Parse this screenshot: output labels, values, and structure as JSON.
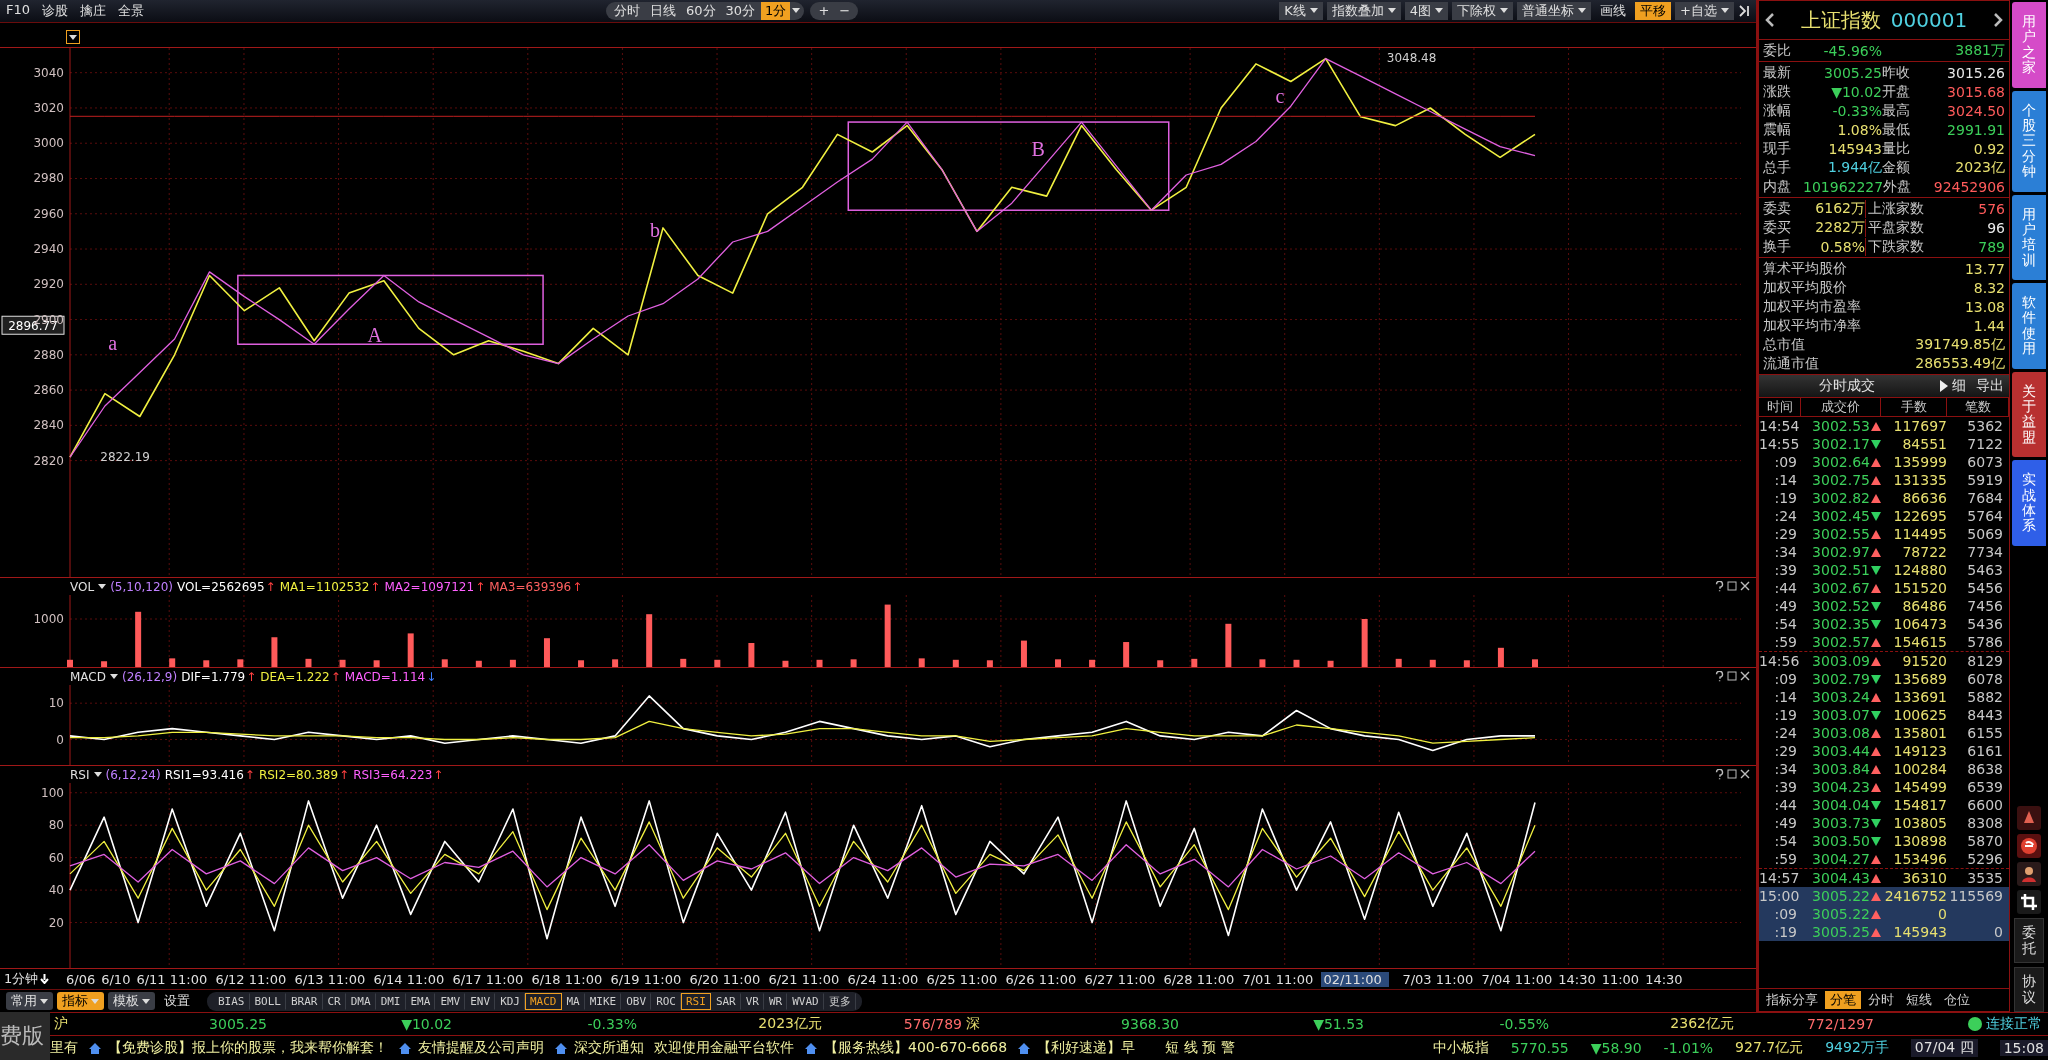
{
  "toolbar": {
    "menu": [
      {
        "label": "F10"
      },
      {
        "label": "诊股"
      },
      {
        "label": "擒庄"
      },
      {
        "label": "全景"
      }
    ],
    "periods": [
      {
        "label": "分时",
        "selected": false
      },
      {
        "label": "日线",
        "selected": false
      },
      {
        "label": "60分",
        "selected": false
      },
      {
        "label": "30分",
        "selected": false
      },
      {
        "label": "1分",
        "selected": true
      }
    ],
    "zoom": [
      "+",
      "−"
    ],
    "tools": [
      {
        "label": "K线",
        "dropdown": true,
        "selected": false
      },
      {
        "label": "指数叠加",
        "dropdown": true,
        "selected": false
      },
      {
        "label": "4图",
        "dropdown": true,
        "selected": false
      },
      {
        "label": "下除权",
        "dropdown": true,
        "selected": false
      },
      {
        "label": "普通坐标",
        "dropdown": true,
        "selected": false
      },
      {
        "label": "画线",
        "dropdown": false,
        "selected": false
      },
      {
        "label": "平移",
        "dropdown": false,
        "selected": true
      },
      {
        "label": "+自选",
        "dropdown": true,
        "selected": false
      }
    ]
  },
  "price_pane": {
    "marks": {
      "wave_labels": [
        "a",
        "A",
        "b",
        "B",
        "c"
      ],
      "low": "2822.19",
      "high": "3048.48",
      "current": "2896.77"
    },
    "chart_data": {
      "type": "line",
      "categories": [
        null,
        null,
        null,
        null,
        null,
        null,
        null,
        null,
        null,
        null,
        null,
        null,
        null,
        null,
        null,
        null,
        null,
        null,
        null,
        null,
        null,
        null,
        null,
        null,
        null,
        null,
        null,
        null,
        null,
        null,
        null,
        null,
        null,
        null,
        null,
        null,
        null,
        null,
        null,
        null,
        null,
        null,
        null
      ],
      "ylim": [
        2754,
        3054
      ],
      "grid": true,
      "yticks": [
        2820,
        2840,
        2860,
        2880,
        2900,
        2920,
        2940,
        2960,
        2980,
        3000,
        3020,
        3040
      ],
      "series": [
        {
          "color": "#f0f040",
          "values": [
            2822,
            2858,
            2845,
            2880,
            2925,
            2905,
            2918,
            2888,
            2915,
            2922,
            2895,
            2880,
            2888,
            2882,
            2875,
            2895,
            2880,
            2952,
            2925,
            2915,
            2960,
            2975,
            3005,
            2995,
            3010,
            2985,
            2950,
            2975,
            2970,
            3010,
            2985,
            2962,
            2975,
            3020,
            3045,
            3035,
            3048,
            3015,
            3010,
            3020,
            3005,
            2992,
            3005
          ]
        },
        {
          "color": "#c02020",
          "values": [
            3015.26,
            3015.26,
            3015.26,
            3015.26,
            3015.26,
            3015.26,
            3015.26,
            3015.26,
            3015.26,
            3015.26,
            3015.26,
            3015.26,
            3015.26,
            3015.26,
            3015.26,
            3015.26,
            3015.26,
            3015.26,
            3015.26,
            3015.26,
            3015.26,
            3015.26,
            3015.26,
            3015.26,
            3015.26,
            3015.26,
            3015.26,
            3015.26,
            3015.26,
            3015.26,
            3015.26,
            3015.26,
            3015.26,
            3015.26,
            3015.26,
            3015.26,
            3015.26,
            3015.26,
            3015.26,
            3015.26,
            3015.26,
            3015.26,
            3015.26
          ]
        },
        {
          "color": "#e060e0",
          "values": [
            2822,
            2851,
            2870,
            2889,
            2927,
            2913,
            2900,
            2886,
            2906,
            2925,
            2910,
            2900,
            2890,
            2880,
            2875,
            2889,
            2902,
            2909,
            2923,
            2944,
            2950,
            2964,
            2978,
            2991,
            3012,
            2985,
            2950,
            2966,
            2989,
            3012,
            2987,
            2962,
            2982,
            2988,
            3001,
            3021,
            3048,
            3038,
            3028,
            3018,
            3008,
            2998,
            2993
          ]
        }
      ]
    }
  },
  "volume_pane": {
    "title": "VOL",
    "params": "(5,10,120)",
    "readings": [
      {
        "text": "VOL=2562695",
        "arrow": "↑",
        "rising": true,
        "color": "#ffffff"
      },
      {
        "text": "MA1=1102532",
        "arrow": "↑",
        "rising": true,
        "color": "#f0f040"
      },
      {
        "text": "MA2=1097121",
        "arrow": "↑",
        "rising": true,
        "color": "#ff60ff"
      },
      {
        "text": "MA3=639396",
        "arrow": "↑",
        "rising": true,
        "color": "#ff6060"
      }
    ],
    "chart_data": {
      "type": "bar",
      "categories": [
        null,
        null,
        null,
        null,
        null,
        null,
        null,
        null,
        null,
        null,
        null,
        null,
        null,
        null,
        null,
        null,
        null,
        null,
        null,
        null,
        null,
        null,
        null,
        null,
        null,
        null,
        null,
        null,
        null,
        null,
        null,
        null,
        null,
        null,
        null,
        null,
        null,
        null,
        null,
        null,
        null,
        null,
        null,
        null
      ],
      "ylim": [
        0,
        1500
      ],
      "yticks": [
        1000
      ],
      "grid": true,
      "series": [
        {
          "color": "#ff5a5a",
          "values": [
            150,
            120,
            1150,
            180,
            140,
            160,
            620,
            170,
            150,
            140,
            700,
            160,
            130,
            150,
            600,
            140,
            160,
            1100,
            170,
            150,
            500,
            130,
            150,
            160,
            1300,
            180,
            150,
            140,
            550,
            160,
            150,
            520,
            140,
            170,
            900,
            160,
            150,
            130,
            1000,
            170,
            150,
            140,
            400,
            160
          ]
        }
      ]
    }
  },
  "macd_pane": {
    "title": "MACD",
    "params": "(26,12,9)",
    "readings": [
      {
        "text": "DIF=1.779",
        "arrow": "↑",
        "rising": true,
        "color": "#ffffff"
      },
      {
        "text": "DEA=1.222",
        "arrow": "↑",
        "rising": true,
        "color": "#f0f040"
      },
      {
        "text": "MACD=1.114",
        "arrow": "↓",
        "rising": false,
        "color": "#ff60ff"
      }
    ],
    "chart_data": {
      "type": "line",
      "categories": [
        null,
        null,
        null,
        null,
        null,
        null,
        null,
        null,
        null,
        null,
        null,
        null,
        null,
        null,
        null,
        null,
        null,
        null,
        null,
        null,
        null,
        null,
        null,
        null,
        null,
        null,
        null,
        null,
        null,
        null,
        null,
        null,
        null,
        null,
        null,
        null,
        null,
        null,
        null,
        null,
        null,
        null,
        null,
        null
      ],
      "ylim": [
        -7,
        15
      ],
      "yticks": [
        0,
        10
      ],
      "grid": true,
      "series": [
        {
          "color": "#ffffff",
          "values": [
            1,
            0,
            2,
            3,
            2,
            1,
            0,
            2,
            1,
            0,
            1,
            -1,
            0,
            1,
            0,
            -1,
            1,
            12,
            3,
            1,
            0,
            2,
            5,
            3,
            1,
            0,
            1,
            -2,
            0,
            1,
            2,
            5,
            1,
            0,
            2,
            1,
            8,
            3,
            1,
            0,
            -3,
            0,
            1,
            1
          ]
        },
        {
          "color": "#f0f040",
          "values": [
            0.5,
            0.5,
            1,
            2,
            2,
            1.5,
            1,
            1,
            1,
            0.5,
            0.5,
            0,
            0,
            0.5,
            0,
            0,
            0.5,
            5,
            3,
            2,
            1,
            1.5,
            3,
            3,
            2,
            1,
            1,
            -0.5,
            0,
            0.5,
            1,
            3,
            2,
            1,
            1,
            1,
            4,
            3,
            2,
            1,
            -1,
            -0.5,
            0,
            0.5
          ]
        }
      ]
    }
  },
  "rsi_pane": {
    "title": "RSI",
    "params": "(6,12,24)",
    "readings": [
      {
        "text": "RSI1=93.416",
        "arrow": "↑",
        "rising": true,
        "color": "#ffffff"
      },
      {
        "text": "RSI2=80.389",
        "arrow": "↑",
        "rising": true,
        "color": "#f0f040"
      },
      {
        "text": "RSI3=64.223",
        "arrow": "↑",
        "rising": true,
        "color": "#ff60ff"
      }
    ],
    "chart_data": {
      "type": "line",
      "categories": [
        null,
        null,
        null,
        null,
        null,
        null,
        null,
        null,
        null,
        null,
        null,
        null,
        null,
        null,
        null,
        null,
        null,
        null,
        null,
        null,
        null,
        null,
        null,
        null,
        null,
        null,
        null,
        null,
        null,
        null,
        null,
        null,
        null,
        null,
        null,
        null,
        null,
        null,
        null,
        null,
        null,
        null,
        null,
        null
      ],
      "ylim": [
        -8,
        106
      ],
      "yticks": [
        20,
        40,
        60,
        80,
        100
      ],
      "grid": true,
      "series": [
        {
          "color": "#ffffff",
          "values": [
            40,
            85,
            20,
            90,
            30,
            75,
            15,
            95,
            35,
            80,
            25,
            70,
            45,
            90,
            10,
            85,
            30,
            95,
            20,
            75,
            40,
            88,
            15,
            80,
            35,
            92,
            25,
            70,
            50,
            85,
            20,
            95,
            30,
            78,
            12,
            90,
            40,
            82,
            22,
            88,
            30,
            75,
            15,
            94
          ]
        },
        {
          "color": "#f0f040",
          "values": [
            50,
            70,
            35,
            78,
            40,
            65,
            30,
            80,
            45,
            70,
            38,
            62,
            50,
            76,
            28,
            72,
            40,
            82,
            35,
            66,
            48,
            75,
            30,
            70,
            45,
            80,
            38,
            62,
            52,
            74,
            35,
            82,
            42,
            68,
            28,
            78,
            48,
            72,
            36,
            76,
            40,
            66,
            30,
            80
          ]
        },
        {
          "color": "#e060e0",
          "values": [
            55,
            62,
            45,
            65,
            50,
            58,
            44,
            66,
            52,
            60,
            47,
            57,
            54,
            64,
            42,
            60,
            50,
            68,
            46,
            58,
            53,
            63,
            44,
            60,
            52,
            66,
            48,
            56,
            55,
            62,
            46,
            68,
            50,
            59,
            42,
            65,
            53,
            61,
            47,
            63,
            50,
            57,
            44,
            64
          ]
        }
      ]
    }
  },
  "x_axis": [
    {
      "text": "1分钟",
      "kind": "unit"
    },
    {
      "text": "6/06",
      "kind": "day"
    },
    {
      "text": "6/10",
      "kind": "day"
    },
    {
      "text": "6/11 11:00",
      "kind": "date"
    },
    {
      "text": "6/12 11:00",
      "kind": "date"
    },
    {
      "text": "6/13 11:00",
      "kind": "date"
    },
    {
      "text": "6/14 11:00",
      "kind": "date"
    },
    {
      "text": "6/17 11:00",
      "kind": "date"
    },
    {
      "text": "6/18 11:00",
      "kind": "date"
    },
    {
      "text": "6/19 11:00",
      "kind": "date"
    },
    {
      "text": "6/20 11:00",
      "kind": "date"
    },
    {
      "text": "6/21 11:00",
      "kind": "date"
    },
    {
      "text": "6/24 11:00",
      "kind": "date"
    },
    {
      "text": "6/25 11:00",
      "kind": "date"
    },
    {
      "text": "6/26 11:00",
      "kind": "date"
    },
    {
      "text": "6/27 11:00",
      "kind": "date"
    },
    {
      "text": "6/28 11:00",
      "kind": "date"
    },
    {
      "text": "7/01 11:00",
      "kind": "date"
    },
    {
      "text": "02/11:00",
      "kind": "cursor"
    },
    {
      "text": "7/03 11:00",
      "kind": "date"
    },
    {
      "text": "7/04 11:00",
      "kind": "day"
    },
    {
      "text": "14:30",
      "kind": "day"
    },
    {
      "text": "11:00",
      "kind": "day"
    },
    {
      "text": "14:30",
      "kind": "day"
    }
  ],
  "indicator_bar": {
    "menus": [
      {
        "label": "常用",
        "kind": "menu",
        "selected": false
      },
      {
        "label": "指标",
        "kind": "menu",
        "selected": true
      },
      {
        "label": "模板",
        "kind": "menu",
        "selected": false
      },
      {
        "label": "设置",
        "kind": "plain",
        "selected": false
      }
    ],
    "indicators": [
      {
        "label": "BIAS",
        "selected": false
      },
      {
        "label": "BOLL",
        "selected": false
      },
      {
        "label": "BRAR",
        "selected": false
      },
      {
        "label": "CR",
        "selected": false
      },
      {
        "label": "DMA",
        "selected": false
      },
      {
        "label": "DMI",
        "selected": false
      },
      {
        "label": "EMA",
        "selected": false
      },
      {
        "label": "EMV",
        "selected": false
      },
      {
        "label": "ENV",
        "selected": false
      },
      {
        "label": "KDJ",
        "selected": false
      },
      {
        "label": "MACD",
        "selected": true
      },
      {
        "label": "MA",
        "selected": false
      },
      {
        "label": "MIKE",
        "selected": false
      },
      {
        "label": "OBV",
        "selected": false
      },
      {
        "label": "ROC",
        "selected": false
      },
      {
        "label": "RSI",
        "selected": true
      },
      {
        "label": "SAR",
        "selected": false
      },
      {
        "label": "VR",
        "selected": false
      },
      {
        "label": "WR",
        "selected": false
      },
      {
        "label": "WVAD",
        "selected": false
      },
      {
        "label": "更多",
        "selected": false
      }
    ]
  },
  "quote_panel": {
    "name": "上证指数",
    "code": "000001",
    "ratio": {
      "label": "委比",
      "value": "-45.96%",
      "amount": "3881万",
      "color": "#3ccf5a"
    },
    "rows": [
      {
        "cells": [
          {
            "label": "最新",
            "value": "3005.25",
            "color": "#3ccf5a"
          },
          {
            "label": "昨收",
            "value": "3015.26",
            "color": "#e8e8e8"
          }
        ]
      },
      {
        "cells": [
          {
            "label": "涨跌",
            "value": "▼10.02",
            "color": "#3ccf5a"
          },
          {
            "label": "开盘",
            "value": "3015.68",
            "color": "#ff5b5b"
          }
        ]
      },
      {
        "cells": [
          {
            "label": "涨幅",
            "value": "-0.33%",
            "color": "#3ccf5a"
          },
          {
            "label": "最高",
            "value": "3024.50",
            "color": "#ff5b5b"
          }
        ]
      },
      {
        "cells": [
          {
            "label": "震幅",
            "value": "1.08%",
            "color": "#e8e070"
          },
          {
            "label": "最低",
            "value": "2991.91",
            "color": "#3ccf5a"
          }
        ]
      },
      {
        "cells": [
          {
            "label": "现手",
            "value": "145943",
            "color": "#e8e070"
          },
          {
            "label": "量比",
            "value": "0.92",
            "color": "#e8e070"
          }
        ]
      },
      {
        "cells": [
          {
            "label": "总手",
            "value": "1.944亿",
            "color": "#4fd0e0"
          },
          {
            "label": "金额",
            "value": "2023亿",
            "color": "#e8e070"
          }
        ]
      },
      {
        "cells": [
          {
            "label": "内盘",
            "value": "101962227",
            "color": "#3ccf5a"
          },
          {
            "label": "外盘",
            "value": "92452906",
            "color": "#ff5b5b"
          }
        ]
      }
    ],
    "breadth": [
      {
        "cells": [
          {
            "label": "委卖",
            "value": "6162万",
            "color": "#e8e070"
          },
          {
            "label": "上涨家数",
            "value": "576",
            "color": "#ff5b5b"
          }
        ]
      },
      {
        "cells": [
          {
            "label": "委买",
            "value": "2282万",
            "color": "#e8e070"
          },
          {
            "label": "平盘家数",
            "value": "96",
            "color": "#e8e8e8"
          }
        ]
      },
      {
        "cells": [
          {
            "label": "换手",
            "value": "0.58%",
            "color": "#e8e070"
          },
          {
            "label": "下跌家数",
            "value": "789",
            "color": "#3ccf5a"
          }
        ]
      }
    ],
    "stats": [
      {
        "label": "算术平均股价",
        "value": "13.77"
      },
      {
        "label": "加权平均股价",
        "value": "8.32"
      },
      {
        "label": "加权平均市盈率",
        "value": "13.08"
      },
      {
        "label": "加权平均市净率",
        "value": "1.44"
      },
      {
        "label": "总市值",
        "value": "391749.85亿"
      },
      {
        "label": "流通市值",
        "value": "286553.49亿"
      }
    ]
  },
  "trades": {
    "title": "分时成交",
    "detail": "细",
    "export": "导出",
    "columns": [
      "时间",
      "成交价",
      "手数",
      "笔数"
    ],
    "rows": [
      {
        "time": "14:54",
        "price": "3002.53",
        "rising": true,
        "volume": "117697",
        "count": "5362",
        "selected": false
      },
      {
        "time": "14:55",
        "price": "3002.17",
        "rising": false,
        "volume": "84551",
        "count": "7122",
        "selected": false
      },
      {
        "time": ":09",
        "price": "3002.64",
        "rising": true,
        "volume": "135999",
        "count": "6073",
        "selected": false
      },
      {
        "time": ":14",
        "price": "3002.75",
        "rising": true,
        "volume": "131335",
        "count": "5919",
        "selected": false
      },
      {
        "time": ":19",
        "price": "3002.82",
        "rising": true,
        "volume": "86636",
        "count": "7684",
        "selected": false
      },
      {
        "time": ":24",
        "price": "3002.45",
        "rising": false,
        "volume": "122695",
        "count": "5764",
        "selected": false
      },
      {
        "time": ":29",
        "price": "3002.55",
        "rising": true,
        "volume": "114495",
        "count": "5069",
        "selected": false
      },
      {
        "time": ":34",
        "price": "3002.97",
        "rising": true,
        "volume": "78722",
        "count": "7734",
        "selected": false
      },
      {
        "time": ":39",
        "price": "3002.51",
        "rising": false,
        "volume": "124880",
        "count": "5463",
        "selected": false
      },
      {
        "time": ":44",
        "price": "3002.67",
        "rising": true,
        "volume": "151520",
        "count": "5456",
        "selected": false
      },
      {
        "time": ":49",
        "price": "3002.52",
        "rising": false,
        "volume": "86486",
        "count": "7456",
        "selected": false
      },
      {
        "time": ":54",
        "price": "3002.35",
        "rising": false,
        "volume": "106473",
        "count": "5436",
        "selected": false
      },
      {
        "time": ":59",
        "price": "3002.57",
        "rising": true,
        "volume": "154615",
        "count": "5786",
        "selected": false
      },
      {
        "time": "14:56",
        "price": "3003.09",
        "rising": true,
        "volume": "91520",
        "count": "8129",
        "selected": false
      },
      {
        "time": ":09",
        "price": "3002.79",
        "rising": false,
        "volume": "135689",
        "count": "6078",
        "selected": false
      },
      {
        "time": ":14",
        "price": "3003.24",
        "rising": true,
        "volume": "133691",
        "count": "5882",
        "selected": false
      },
      {
        "time": ":19",
        "price": "3003.07",
        "rising": false,
        "volume": "100625",
        "count": "8443",
        "selected": false
      },
      {
        "time": ":24",
        "price": "3003.08",
        "rising": true,
        "volume": "135801",
        "count": "6155",
        "selected": false
      },
      {
        "time": ":29",
        "price": "3003.44",
        "rising": true,
        "volume": "149123",
        "count": "6161",
        "selected": false
      },
      {
        "time": ":34",
        "price": "3003.84",
        "rising": true,
        "volume": "100284",
        "count": "8638",
        "selected": false
      },
      {
        "time": ":39",
        "price": "3004.23",
        "rising": true,
        "volume": "145499",
        "count": "6539",
        "selected": false
      },
      {
        "time": ":44",
        "price": "3004.04",
        "rising": false,
        "volume": "154817",
        "count": "6600",
        "selected": false
      },
      {
        "time": ":49",
        "price": "3003.73",
        "rising": false,
        "volume": "103805",
        "count": "8308",
        "selected": false
      },
      {
        "time": ":54",
        "price": "3003.50",
        "rising": false,
        "volume": "130898",
        "count": "5870",
        "selected": false
      },
      {
        "time": ":59",
        "price": "3004.27",
        "rising": true,
        "volume": "153496",
        "count": "5296",
        "selected": false
      },
      {
        "time": "14:57",
        "price": "3004.43",
        "rising": true,
        "volume": "36310",
        "count": "3535",
        "selected": false
      },
      {
        "time": "15:00",
        "price": "3005.22",
        "rising": true,
        "volume": "2416752",
        "count": "115569",
        "selected": true
      },
      {
        "time": ":09",
        "price": "3005.22",
        "rising": true,
        "volume": "0",
        "selected": true
      },
      {
        "time": ":19",
        "price": "3005.25",
        "rising": true,
        "volume": "145943",
        "count": "0",
        "selected": true
      }
    ],
    "tabs": [
      {
        "label": "指标分享",
        "selected": false
      },
      {
        "label": "分笔",
        "selected": true
      },
      {
        "label": "分时",
        "selected": false
      },
      {
        "label": "短线",
        "selected": false
      },
      {
        "label": "仓位",
        "selected": false
      }
    ]
  },
  "side_tabs": [
    {
      "label": "用户之家",
      "color": "#d54bc8"
    },
    {
      "label": "个股三分钟",
      "color": "#2b7fd6"
    },
    {
      "label": "用户培训",
      "color": "#2b7fd6"
    },
    {
      "label": "软件使用",
      "color": "#2b7fd6"
    },
    {
      "label": "关于益盟",
      "color": "#b83030"
    },
    {
      "label": "实战体系",
      "color": "#2f5fe8"
    }
  ],
  "side_buttons": [
    "委托",
    "协议"
  ],
  "status_bar": {
    "edition": "费版",
    "markets": [
      {
        "name": "沪",
        "price": "3005.25",
        "change": "▼10.02",
        "percent": "-0.33%",
        "amount": "2023亿元",
        "breadth": "576/789"
      },
      {
        "name": "深",
        "price": "9368.30",
        "change": "▼51.53",
        "percent": "-0.55%",
        "amount": "2362亿元",
        "breadth": "772/1297"
      }
    ],
    "connection": "连接正常",
    "ticker": [
      {
        "kind": "text",
        "text": "里有"
      },
      {
        "kind": "notice",
        "text": "【免费诊股】报上你的股票，我来帮你解套！"
      },
      {
        "kind": "notice",
        "text": "友情提醒及公司声明"
      },
      {
        "kind": "notice",
        "text": "深交所通知"
      },
      {
        "kind": "text",
        "text": "欢迎使用金融平台软件"
      },
      {
        "kind": "notice",
        "text": "【服务热线】400-670-6668"
      },
      {
        "kind": "notice",
        "text": "【利好速递】早"
      }
    ],
    "alert": "短 线 预 警",
    "index": {
      "name": "中小板指",
      "price": "5770.55",
      "change": "▼58.90",
      "percent": "-1.01%",
      "amount": "927.7亿元",
      "volume": "9492万手"
    },
    "date": "07/04 四",
    "time": "15:08"
  }
}
